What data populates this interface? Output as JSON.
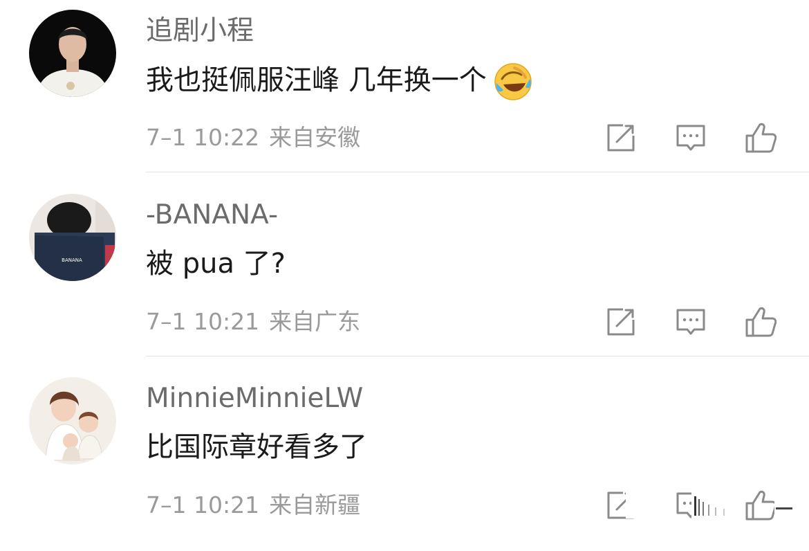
{
  "comments": [
    {
      "username": "追剧小程",
      "text": "我也挺佩服汪峰  几年换一个",
      "emoji": "laughing-crying-emoji",
      "time": "7–1 10:22",
      "location": "来自安徽"
    },
    {
      "username": "-BANANA-",
      "text": "被 pua 了?",
      "time": "7–1 10:21",
      "location": "来自广东",
      "avatar_book_text": "BANANA"
    },
    {
      "username": "MinnieMinnieLW",
      "text": "比国际章好看多了",
      "time": "7–1 10:21",
      "location": "来自新疆"
    }
  ],
  "icons": {
    "repost": "repost-icon",
    "reply": "comment-icon",
    "like": "thumbs-up-icon"
  },
  "colors": {
    "username": "#6b6b6b",
    "text": "#1a1a1a",
    "meta": "#9a9a9a",
    "icon": "#8a8a8a",
    "divider": "#e3e3e3"
  }
}
